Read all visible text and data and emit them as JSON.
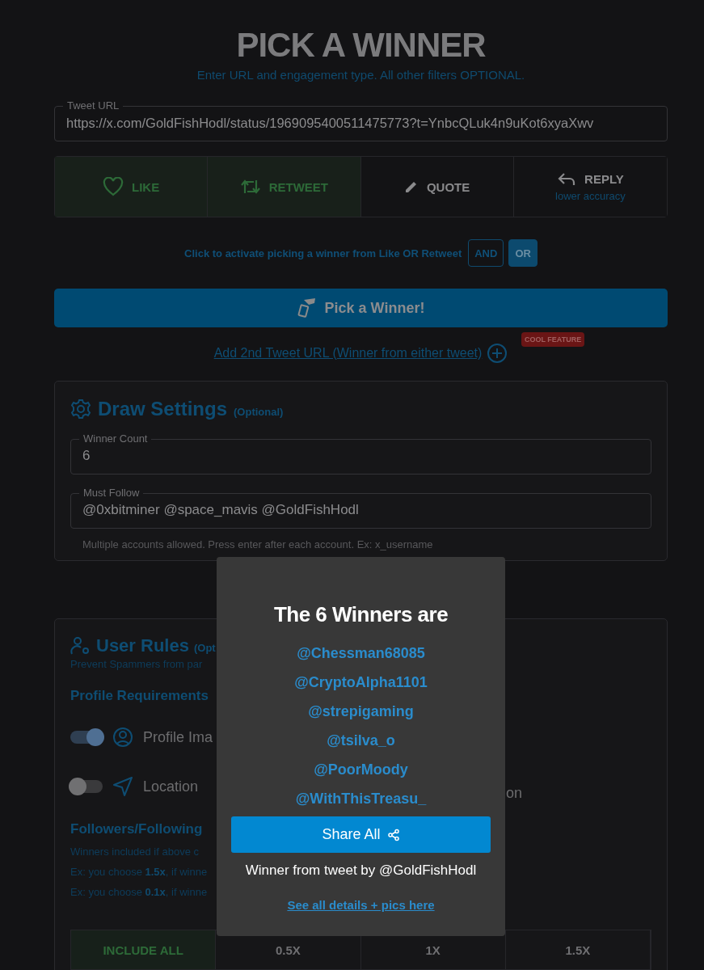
{
  "header": {
    "title": "PICK A WINNER",
    "subtitle": "Enter URL and engagement type. All other filters OPTIONAL."
  },
  "tweet_url": {
    "label": "Tweet URL",
    "value": "https://x.com/GoldFishHodl/status/1969095400511475773?t=YnbcQLuk4n9uKot6xyaXwv"
  },
  "engagement": [
    {
      "kind": "like",
      "label": "LIKE",
      "selected": true
    },
    {
      "kind": "retweet",
      "label": "RETWEET",
      "selected": true
    },
    {
      "kind": "quote",
      "label": "QUOTE",
      "selected": false
    },
    {
      "kind": "reply",
      "label": "REPLY",
      "note": "lower accuracy",
      "selected": false
    }
  ],
  "logic": {
    "text": "Click to activate picking a winner from Like OR Retweet",
    "options": [
      {
        "label": "AND",
        "selected": false
      },
      {
        "label": "OR",
        "selected": true
      }
    ]
  },
  "pick_button": "Pick a Winner!",
  "second_url": {
    "link": "Add 2nd Tweet URL (Winner from either tweet)",
    "badge": "COOL FEATURE"
  },
  "draw_settings": {
    "title": "Draw Settings",
    "note": "(Optional)",
    "fields": [
      {
        "label": "Winner Count",
        "value": "6"
      },
      {
        "label": "Must Follow",
        "value": "@0xbitminer @space_mavis @GoldFishHodl",
        "hint": "Multiple accounts allowed. Press enter after each account. Ex: x_username"
      }
    ]
  },
  "user_rules": {
    "title": "User Rules",
    "note": "(Opt",
    "subtitle": "Prevent Spammers from par",
    "profile_heading": "Profile Requirements",
    "toggles": [
      {
        "kind": "person",
        "label": "Profile Ima",
        "on": true
      },
      {
        "kind": "location",
        "label": "Location",
        "on": false
      }
    ],
    "toggle_fragment": "on",
    "ratio_heading": "Followers/Following",
    "ratio_lines": [
      "Winners included if above c",
      "Ex: you choose **1.5x**, if winne",
      "Ex: you choose **0.1x**, if winne"
    ],
    "ratio_options": [
      {
        "label": "INCLUDE ALL",
        "selected": true
      },
      {
        "label": "0.5X",
        "selected": false
      },
      {
        "label": "1X",
        "selected": false
      },
      {
        "label": "1.5X",
        "selected": false
      }
    ]
  },
  "modal": {
    "title": "The 6 Winners are",
    "winners": [
      "@Chessman68085",
      "@CryptoAlpha1101",
      "@strepigaming",
      "@tsilva_o",
      "@PoorMoody",
      "@WithThisTreasu_"
    ],
    "share_button": "Share All",
    "source": "Winner from tweet by @GoldFishHodl",
    "details_link": "See all details + pics here"
  }
}
